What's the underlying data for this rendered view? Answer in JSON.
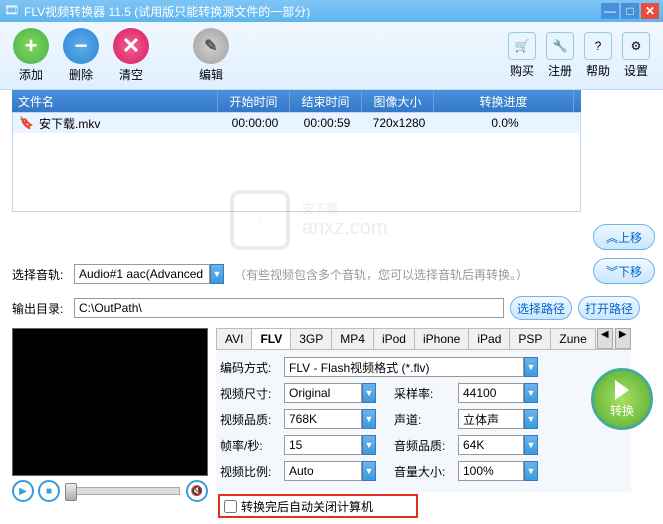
{
  "title": "FLV视频转换器 11.5 (试用版只能转换源文件的一部分)",
  "toolbar": {
    "add": "添加",
    "del": "删除",
    "clear": "清空",
    "edit": "编辑",
    "buy": "购买",
    "register": "注册",
    "help": "帮助",
    "settings": "设置"
  },
  "columns": {
    "name": "文件名",
    "start": "开始时间",
    "end": "结束时间",
    "size": "图像大小",
    "progress": "转换进度"
  },
  "files": [
    {
      "name": "安下载.mkv",
      "start": "00:00:00",
      "end": "00:00:59",
      "size": "720x1280",
      "progress": "0.0%"
    }
  ],
  "side": {
    "up": "上移",
    "down": "下移"
  },
  "audio": {
    "label": "选择音轨:",
    "value": "Audio#1 aac(Advanced",
    "hint": "（有些视频包含多个音轨，您可以选择音轨后再转换。）"
  },
  "output": {
    "label": "输出目录:",
    "value": "C:\\OutPath\\",
    "choose": "选择路径",
    "open": "打开路径"
  },
  "tabs": [
    "AVI",
    "FLV",
    "3GP",
    "MP4",
    "iPod",
    "iPhone",
    "iPad",
    "PSP",
    "Zune"
  ],
  "activeTab": "FLV",
  "settingsPanel": {
    "encoding": {
      "label": "编码方式:",
      "value": "FLV - Flash视频格式 (*.flv)"
    },
    "videoSize": {
      "label": "视频尺寸:",
      "value": "Original"
    },
    "sampleRate": {
      "label": "采样率:",
      "value": "44100"
    },
    "videoQuality": {
      "label": "视频品质:",
      "value": "768K"
    },
    "channels": {
      "label": "声道:",
      "value": "立体声"
    },
    "fps": {
      "label": "帧率/秒:",
      "value": "15"
    },
    "audioQuality": {
      "label": "音频品质:",
      "value": "64K"
    },
    "videoRatio": {
      "label": "视频比例:",
      "value": "Auto"
    },
    "volume": {
      "label": "音量大小:",
      "value": "100%"
    }
  },
  "convert": "转换",
  "footer": {
    "autoShutdown": "转换完后自动关闭计算机"
  },
  "watermark": {
    "text1": "安下载",
    "text2": "anxz.com"
  }
}
